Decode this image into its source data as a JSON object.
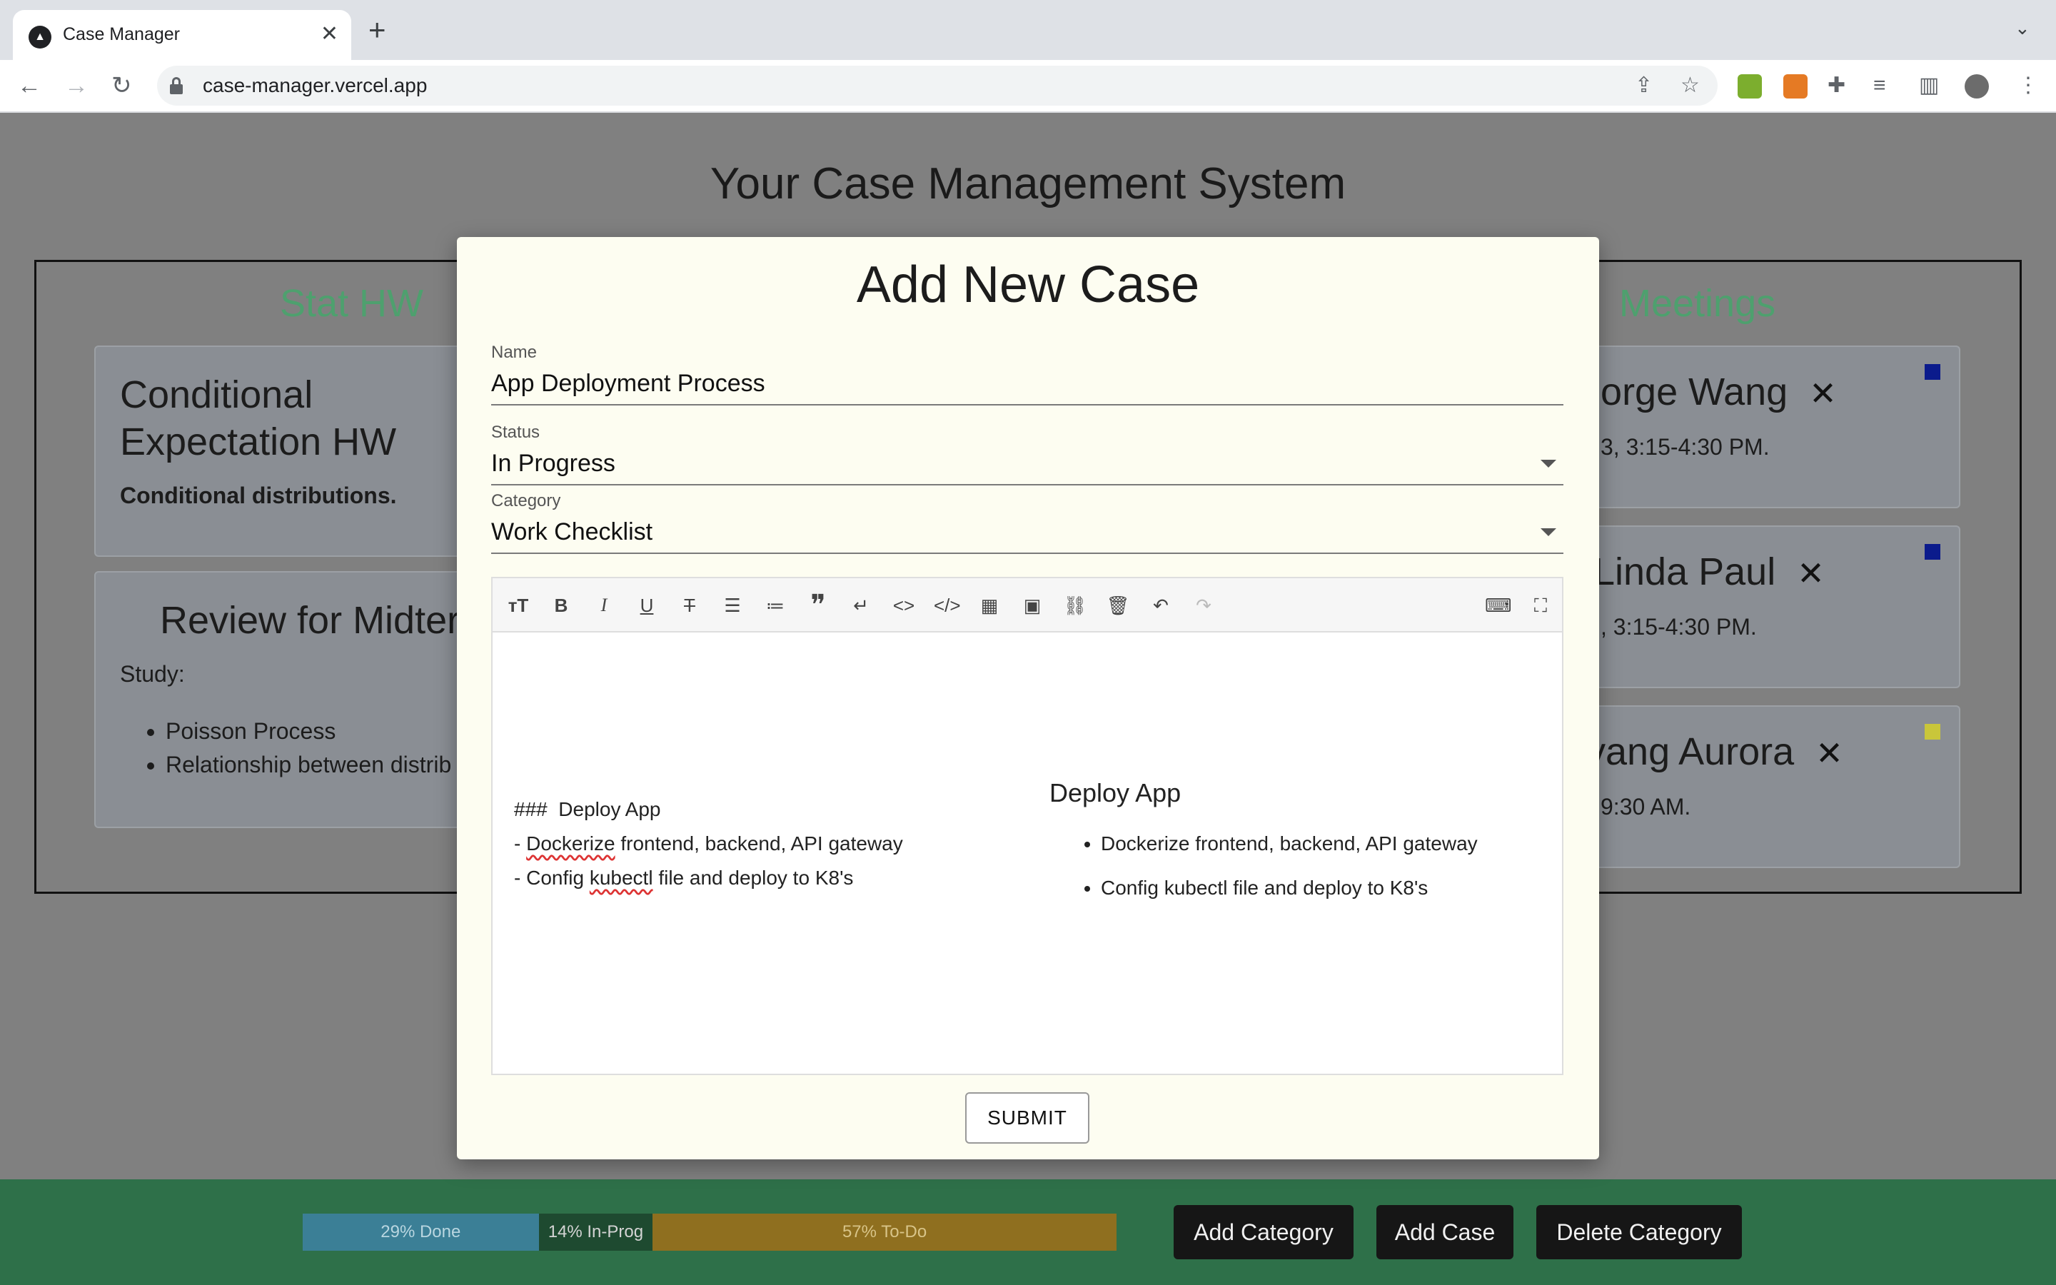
{
  "browser": {
    "tab_title": "Case Manager",
    "url": "case-manager.vercel.app"
  },
  "page": {
    "title": "Your Case Management System"
  },
  "columns": [
    {
      "title": "Stat HW",
      "cards": [
        {
          "title": "Conditional Expectation HW",
          "subtitle": "Conditional distributions."
        },
        {
          "title": "Review for Midter",
          "intro": "Study:",
          "items": [
            "Poisson Process",
            "Relationship between distrib"
          ]
        }
      ]
    },
    {
      "title": "Meetings",
      "cards": [
        {
          "title": "eorge Wang",
          "time": "3, 3:15-4:30 PM.",
          "color": "#0b1b8c"
        },
        {
          "title": "Linda Paul",
          "time": ", 3:15-4:30 PM.",
          "color": "#0b1b8c"
        },
        {
          "title": "yang Aurora",
          "time": "9:30 AM.",
          "color": "#c9c63a"
        }
      ]
    }
  ],
  "modal": {
    "title": "Add New Case",
    "name_label": "Name",
    "name_value": "App Deployment Process",
    "status_label": "Status",
    "status_value": "In Progress",
    "category_label": "Category",
    "category_value": "Work Checklist",
    "editor": {
      "source": {
        "heading_prefix": "###",
        "heading_text": "Deploy App",
        "line1_dash": "- ",
        "line1_word": "Dockerize",
        "line1_rest": " frontend, backend, API gateway",
        "line2_start": "- Config ",
        "line2_word": "kubectl",
        "line2_rest": " file and deploy to K8's"
      },
      "preview": {
        "heading": "Deploy App",
        "items": [
          "Dockerize frontend, backend, API gateway",
          "Config kubectl file and deploy to K8's"
        ]
      }
    },
    "submit_label": "SUBMIT"
  },
  "progress": [
    {
      "label": "29% Done",
      "fraction": 0.29,
      "color": "#3b7f96"
    },
    {
      "label": "14% In-Prog",
      "fraction": 0.14,
      "color": "#1e4a30"
    },
    {
      "label": "57% To-Do",
      "fraction": 0.57,
      "color": "#8f6f1f"
    }
  ],
  "actions": {
    "add_category": "Add Category",
    "add_case": "Add Case",
    "delete_category": "Delete Category"
  }
}
